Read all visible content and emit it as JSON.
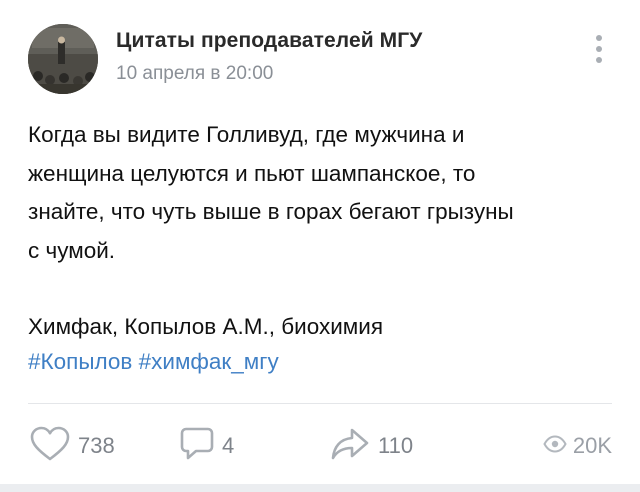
{
  "post": {
    "author": "Цитаты преподавателей МГУ",
    "date": "10 апреля в 20:00",
    "text": "Когда вы видите Голливуд, где мужчина и\nженщина целуются и пьют шампанское, то\nзнайте, что чуть выше в горах бегают грызуны\nс чумой.",
    "signature": "Химфак, Копылов А.М., биохимия",
    "tags": [
      "#Копылов",
      "#химфак_мгу"
    ]
  },
  "actions": {
    "likes": {
      "icon": "heart-icon",
      "count": "738"
    },
    "comments": {
      "icon": "comment-icon",
      "count": "4"
    },
    "shares": {
      "icon": "share-icon",
      "count": "110"
    },
    "views": {
      "icon": "eye-icon",
      "count": "20K"
    }
  },
  "colors": {
    "link": "#3f7fc5",
    "muted": "#8a8f96",
    "icon": "#a9aeb4"
  }
}
